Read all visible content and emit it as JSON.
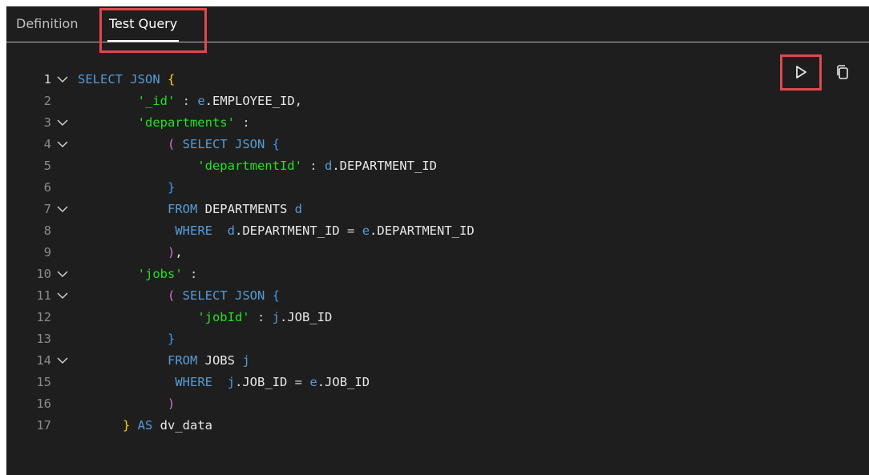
{
  "tabs": [
    {
      "label": "Definition",
      "active": false
    },
    {
      "label": "Test Query",
      "active": true
    }
  ],
  "toolbar": {
    "run_icon": "play-icon",
    "copy_icon": "copy-icon"
  },
  "colors": {
    "background": "#1e1e1e",
    "keyword": "#569cd6",
    "string": "#22e022",
    "identifier": "#e8e8e8",
    "bracket_level1": "#ffd700",
    "bracket_level2": "#da70d6",
    "bracket_level3": "#3b9cf0",
    "highlight_box": "#e0484f"
  },
  "editor": {
    "lines": [
      {
        "number": "1",
        "foldable": true,
        "tokens": [
          {
            "t": "SELECT JSON ",
            "c": "kw"
          },
          {
            "t": "{",
            "c": "b1"
          }
        ]
      },
      {
        "number": "2",
        "foldable": false,
        "tokens": [
          {
            "t": "        ",
            "c": "id"
          },
          {
            "t": "'_id'",
            "c": "str"
          },
          {
            "t": " : ",
            "c": "op"
          },
          {
            "t": "e",
            "c": "ali"
          },
          {
            "t": ".EMPLOYEE_ID,",
            "c": "id"
          }
        ]
      },
      {
        "number": "3",
        "foldable": true,
        "tokens": [
          {
            "t": "        ",
            "c": "id"
          },
          {
            "t": "'departments'",
            "c": "str"
          },
          {
            "t": " :",
            "c": "op"
          }
        ]
      },
      {
        "number": "4",
        "foldable": true,
        "tokens": [
          {
            "t": "            ",
            "c": "id"
          },
          {
            "t": "(",
            "c": "b2"
          },
          {
            "t": " SELECT JSON ",
            "c": "kw"
          },
          {
            "t": "{",
            "c": "b3"
          }
        ]
      },
      {
        "number": "5",
        "foldable": false,
        "tokens": [
          {
            "t": "                ",
            "c": "id"
          },
          {
            "t": "'departmentId'",
            "c": "str"
          },
          {
            "t": " : ",
            "c": "op"
          },
          {
            "t": "d",
            "c": "ali"
          },
          {
            "t": ".DEPARTMENT_ID",
            "c": "id"
          }
        ]
      },
      {
        "number": "6",
        "foldable": false,
        "tokens": [
          {
            "t": "            ",
            "c": "id"
          },
          {
            "t": "}",
            "c": "b3"
          }
        ]
      },
      {
        "number": "7",
        "foldable": true,
        "tokens": [
          {
            "t": "            ",
            "c": "id"
          },
          {
            "t": "FROM",
            "c": "kw"
          },
          {
            "t": " DEPARTMENTS ",
            "c": "id"
          },
          {
            "t": "d",
            "c": "ali"
          }
        ]
      },
      {
        "number": "8",
        "foldable": false,
        "tokens": [
          {
            "t": "             ",
            "c": "id"
          },
          {
            "t": "WHERE",
            "c": "kw"
          },
          {
            "t": "  ",
            "c": "id"
          },
          {
            "t": "d",
            "c": "ali"
          },
          {
            "t": ".DEPARTMENT_ID ",
            "c": "id"
          },
          {
            "t": "=",
            "c": "op"
          },
          {
            "t": " ",
            "c": "id"
          },
          {
            "t": "e",
            "c": "ali"
          },
          {
            "t": ".DEPARTMENT_ID",
            "c": "id"
          }
        ]
      },
      {
        "number": "9",
        "foldable": false,
        "tokens": [
          {
            "t": "            ",
            "c": "id"
          },
          {
            "t": ")",
            "c": "b2"
          },
          {
            "t": ",",
            "c": "id"
          }
        ]
      },
      {
        "number": "10",
        "foldable": true,
        "tokens": [
          {
            "t": "        ",
            "c": "id"
          },
          {
            "t": "'jobs'",
            "c": "str"
          },
          {
            "t": " :",
            "c": "op"
          }
        ]
      },
      {
        "number": "11",
        "foldable": true,
        "tokens": [
          {
            "t": "            ",
            "c": "id"
          },
          {
            "t": "(",
            "c": "b2"
          },
          {
            "t": " SELECT JSON ",
            "c": "kw"
          },
          {
            "t": "{",
            "c": "b3"
          }
        ]
      },
      {
        "number": "12",
        "foldable": false,
        "tokens": [
          {
            "t": "                ",
            "c": "id"
          },
          {
            "t": "'jobId'",
            "c": "str"
          },
          {
            "t": " : ",
            "c": "op"
          },
          {
            "t": "j",
            "c": "ali"
          },
          {
            "t": ".JOB_ID",
            "c": "id"
          }
        ]
      },
      {
        "number": "13",
        "foldable": false,
        "tokens": [
          {
            "t": "            ",
            "c": "id"
          },
          {
            "t": "}",
            "c": "b3"
          }
        ]
      },
      {
        "number": "14",
        "foldable": true,
        "tokens": [
          {
            "t": "            ",
            "c": "id"
          },
          {
            "t": "FROM",
            "c": "kw"
          },
          {
            "t": " JOBS ",
            "c": "id"
          },
          {
            "t": "j",
            "c": "ali"
          }
        ]
      },
      {
        "number": "15",
        "foldable": false,
        "tokens": [
          {
            "t": "             ",
            "c": "id"
          },
          {
            "t": "WHERE",
            "c": "kw"
          },
          {
            "t": "  ",
            "c": "id"
          },
          {
            "t": "j",
            "c": "ali"
          },
          {
            "t": ".JOB_ID ",
            "c": "id"
          },
          {
            "t": "=",
            "c": "op"
          },
          {
            "t": " ",
            "c": "id"
          },
          {
            "t": "e",
            "c": "ali"
          },
          {
            "t": ".JOB_ID",
            "c": "id"
          }
        ]
      },
      {
        "number": "16",
        "foldable": false,
        "tokens": [
          {
            "t": "            ",
            "c": "id"
          },
          {
            "t": ")",
            "c": "b2"
          }
        ]
      },
      {
        "number": "17",
        "foldable": false,
        "tokens": [
          {
            "t": "      ",
            "c": "id"
          },
          {
            "t": "}",
            "c": "b1"
          },
          {
            "t": " AS",
            "c": "kw"
          },
          {
            "t": " dv_data",
            "c": "id"
          }
        ]
      }
    ]
  }
}
